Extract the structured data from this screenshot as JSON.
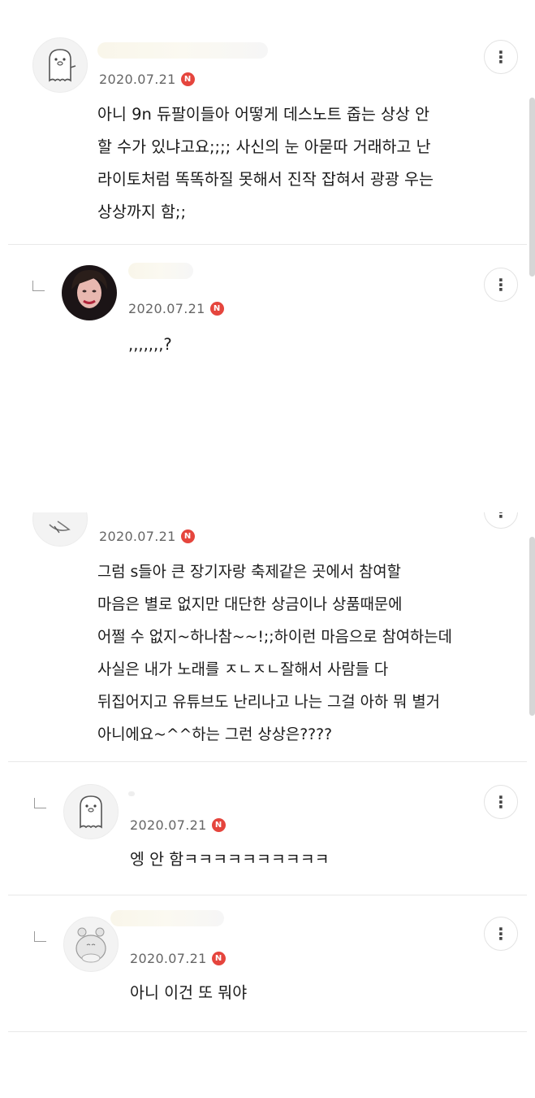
{
  "comments": [
    {
      "date": "2020.07.21",
      "badge": "N",
      "text": "아니 9n 듀팔이들아 어떻게 데스노트 줍는 상상 안\n할 수가 있냐고요;;;; 사신의 눈 아묻따 거래하고 난\n라이토처럼 똑똑하질 못해서 진작 잡혀서 광광 우는\n상상까지 함;;",
      "avatar_icon": "ghost-avatar-icon"
    },
    {
      "date": "2020.07.21",
      "badge": "N",
      "text": ",,,,,,,?",
      "avatar_icon": "photo-avatar"
    },
    {
      "date": "2020.07.21",
      "badge": "N",
      "text": "그럼 s들아 큰 장기자랑 축제같은 곳에서 참여할\n마음은 별로 없지만 대단한 상금이나 상품때문에\n어쩔 수 없지~하나참~~!;;하이런 마음으로 참여하는데\n사실은 내가 노래를 ㅈㄴㅈㄴ잘해서 사람들 다\n뒤집어지고 유튜브도 난리나고 나는 그걸 아하 뭐 별거\n아니에요~^^하는 그런 상상은????",
      "avatar_icon": "cropped-avatar"
    },
    {
      "date": "2020.07.21",
      "badge": "N",
      "text": "엥 안 함ㅋㅋㅋㅋㅋㅋㅋㅋㅋㅋ",
      "avatar_icon": "ghost-avatar-icon"
    },
    {
      "date": "2020.07.21",
      "badge": "N",
      "text": "아니 이건 또 뭐야",
      "avatar_icon": "hamster-avatar-icon"
    }
  ],
  "icons": {
    "more": "more-vertical-icon",
    "reply": "reply-arrow-icon",
    "badge_color": "#e5453d"
  }
}
